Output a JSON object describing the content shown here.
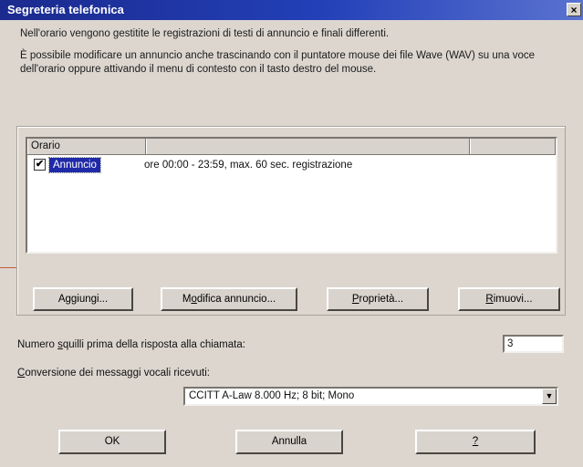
{
  "window": {
    "title": "Segreteria telefonica",
    "close_glyph": "×"
  },
  "description": {
    "line1": "Nell'orario vengono gestitite le registrazioni di testi di annuncio e finali differenti.",
    "line2": "È possibile modificare un annuncio anche trascinando con il puntatore mouse dei file Wave (WAV) su una voce dell'orario oppure attivando il menu di contesto con il tasto destro del mouse."
  },
  "schedule_list": {
    "columns": [
      "Orario",
      "",
      ""
    ],
    "rows": [
      {
        "checked": true,
        "check_glyph": "✔",
        "label": "Annuncio",
        "detail": "ore 00:00 - 23:59, max. 60 sec. registrazione"
      }
    ]
  },
  "list_buttons": {
    "add": {
      "prefix": "A",
      "accel": "g",
      "rest": "giungi..."
    },
    "edit": {
      "prefix": "M",
      "accel": "o",
      "rest": "difica annuncio..."
    },
    "props": {
      "prefix": "",
      "accel": "P",
      "rest": "roprietà..."
    },
    "remove": {
      "prefix": "",
      "accel": "R",
      "rest": "imuovi..."
    }
  },
  "rings": {
    "label_pre": "Numero ",
    "label_accel": "s",
    "label_post": "quilli prima della risposta alla chiamata:",
    "value": "3"
  },
  "conversion": {
    "label_accel": "C",
    "label_rest": "onversione dei messaggi vocali ricevuti:",
    "selected": "CCITT A-Law 8.000 Hz; 8 bit; Mono",
    "arrow_glyph": "▼"
  },
  "footer_buttons": {
    "ok": "OK",
    "cancel": "Annulla",
    "help": "?"
  },
  "colors": {
    "title_bar": "#1b2a8e",
    "dialog_bg": "#dcd6cf",
    "selection": "#1f2aa8"
  }
}
